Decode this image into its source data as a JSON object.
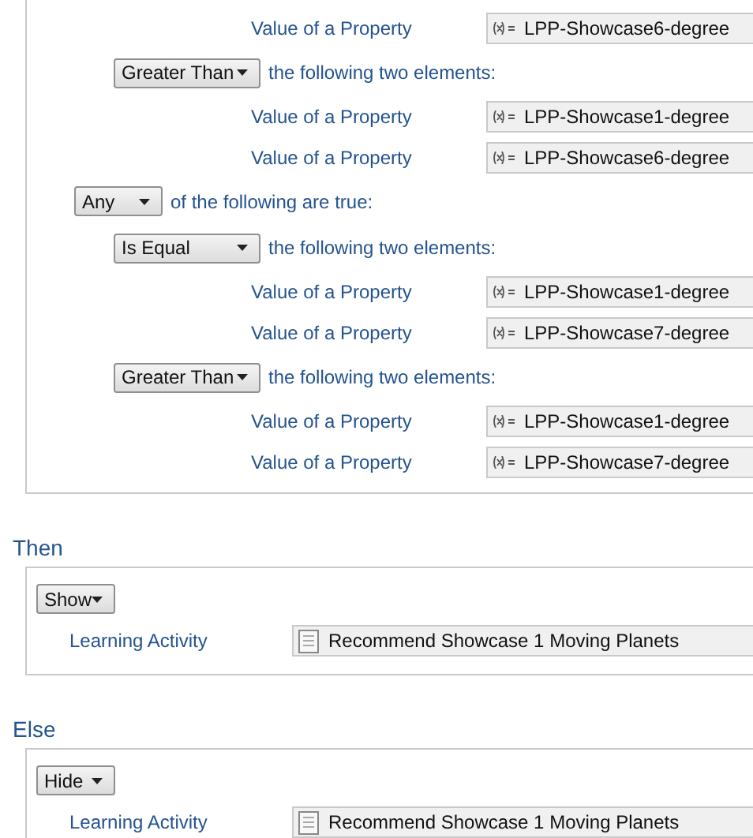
{
  "condition_panel": {
    "rows": [
      {
        "kind": "property",
        "label": "Value of a Property",
        "value": "LPP-Showcase6-degree"
      },
      {
        "kind": "operator",
        "selector": "Greater Than",
        "text": "the following two elements:",
        "children": [
          {
            "kind": "property",
            "label": "Value of a Property",
            "value": "LPP-Showcase1-degree"
          },
          {
            "kind": "property",
            "label": "Value of a Property",
            "value": "LPP-Showcase6-degree"
          }
        ]
      }
    ],
    "group": {
      "selector": "Any",
      "text": "of the following are true:",
      "children": [
        {
          "kind": "operator",
          "selector": "Is Equal",
          "text": "the following two elements:",
          "children": [
            {
              "kind": "property",
              "label": "Value of a Property",
              "value": "LPP-Showcase1-degree"
            },
            {
              "kind": "property",
              "label": "Value of a Property",
              "value": "LPP-Showcase7-degree"
            }
          ]
        },
        {
          "kind": "operator",
          "selector": "Greater Than",
          "text": "the following two elements:",
          "children": [
            {
              "kind": "property",
              "label": "Value of a Property",
              "value": "LPP-Showcase1-degree"
            },
            {
              "kind": "property",
              "label": "Value of a Property",
              "value": "LPP-Showcase7-degree"
            }
          ]
        }
      ]
    }
  },
  "then": {
    "title": "Then",
    "action": "Show",
    "label": "Learning Activity",
    "value": "Recommend Showcase 1 Moving Planets"
  },
  "else": {
    "title": "Else",
    "action": "Hide",
    "label": "Learning Activity",
    "value": "Recommend Showcase 1 Moving Planets"
  }
}
